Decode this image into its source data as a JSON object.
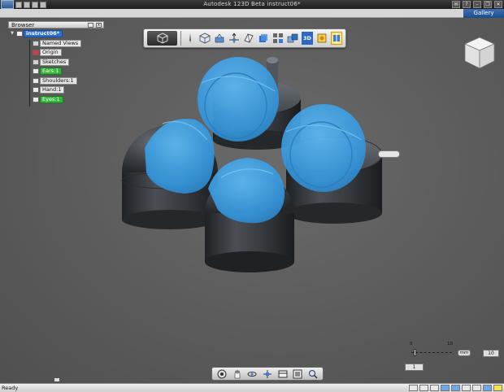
{
  "titlebar": {
    "title": "Autodesk 123D Beta   instruct06*"
  },
  "gallery": {
    "label": "Gallery"
  },
  "browser": {
    "title": "Browser",
    "items": [
      {
        "label": "instruct06*",
        "kind": "root"
      },
      {
        "label": "Named Views",
        "kind": "folder"
      },
      {
        "label": "Origin",
        "kind": "origin"
      },
      {
        "label": "Sketches",
        "kind": "folder"
      },
      {
        "label": "Ears:1",
        "kind": "green"
      },
      {
        "label": "Shoulders:1",
        "kind": "part"
      },
      {
        "label": "Hand:1",
        "kind": "part"
      },
      {
        "label": "Eyes:1",
        "kind": "green"
      }
    ]
  },
  "toolbar": {
    "three_d_label": "3D"
  },
  "zoom": {
    "tick_min": "0",
    "tick_max": "10",
    "unit": "mm",
    "value_right": "10",
    "value_left": "1"
  },
  "status": {
    "text": "Ready"
  },
  "colors": {
    "accent_blue": "#2b6fd1",
    "part_blue": "#3b9be2",
    "active_green": "#35b53b",
    "metal_grey": "#3f4347"
  }
}
